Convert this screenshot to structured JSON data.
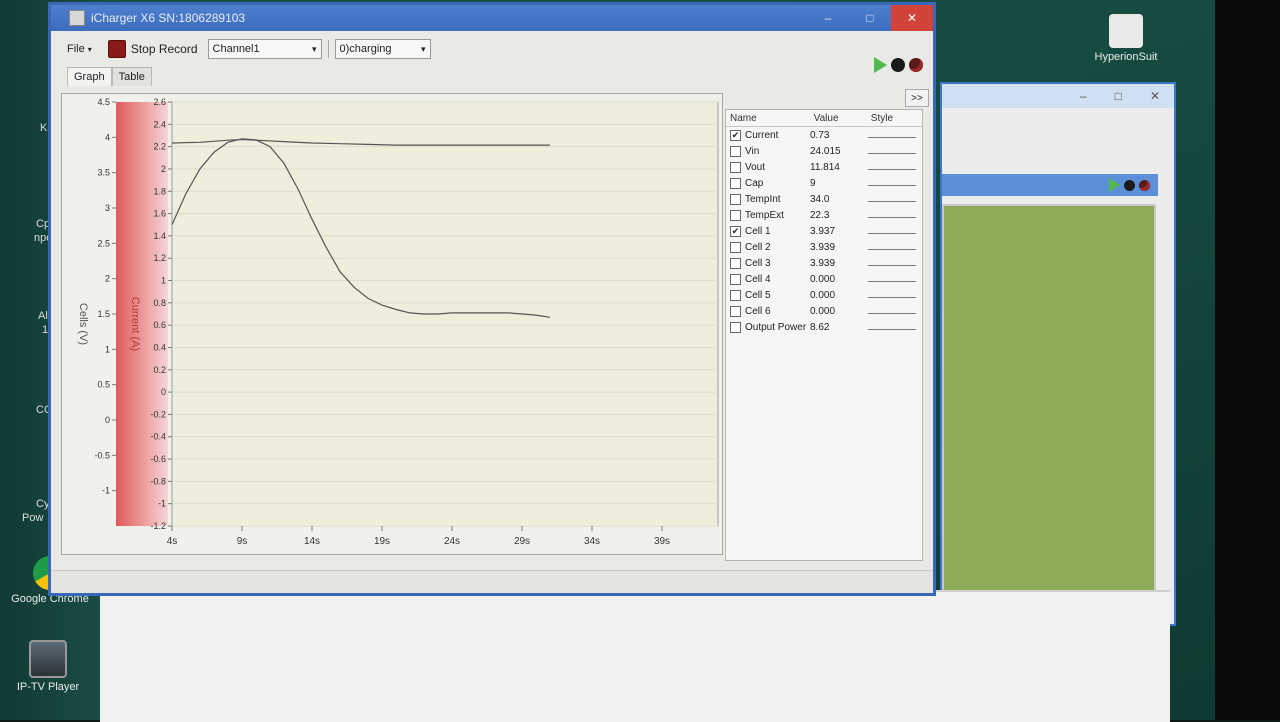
{
  "desktop": {
    "icons": [
      {
        "name": "HyperionSuit"
      },
      {
        "name": "Google Chrome"
      },
      {
        "name": "IP-TV Player"
      }
    ],
    "edge_labels": [
      "Kc",
      "Cp",
      "npc",
      "Al",
      "1",
      "CC",
      "Cy",
      "Pow"
    ]
  },
  "window": {
    "title": "iCharger X6 SN:1806289103",
    "controls": [
      "–",
      "□",
      "✕"
    ]
  },
  "toolbar": {
    "file": "File",
    "stop_record": "Stop Record",
    "channel": "Channel1",
    "mode": "0)charging"
  },
  "tabs": [
    {
      "label": "Graph",
      "active": true
    },
    {
      "label": "Table",
      "active": false
    }
  ],
  "expand_label": ">>",
  "chart_data": {
    "type": "line",
    "x_ticks": [
      "4s",
      "9s",
      "14s",
      "19s",
      "24s",
      "29s",
      "34s",
      "39s"
    ],
    "x_range_s": [
      4,
      43
    ],
    "left_axis": {
      "label": "Cells (V)",
      "range": [
        -1.5,
        4.5
      ],
      "ticks": [
        "4.5",
        "4",
        "3.5",
        "3",
        "2.5",
        "2",
        "1.5",
        "1",
        "0.5",
        "0",
        "-0.5",
        "-1"
      ]
    },
    "right_axis": {
      "label": "Current (A)",
      "range": [
        -1.2,
        2.6
      ],
      "ticks": [
        "2.6",
        "2.4",
        "2.2",
        "2",
        "1.8",
        "1.6",
        "1.4",
        "1.2",
        "1",
        "0.8",
        "0.6",
        "0.4",
        "0.2",
        "0",
        "-0.2",
        "-0.4",
        "-0.6",
        "-0.8",
        "-1",
        "-1.2"
      ]
    },
    "series": [
      {
        "name": "Current",
        "axis": "right",
        "color": "#555555",
        "x": [
          4,
          5,
          6,
          7,
          8,
          9,
          10,
          11,
          12,
          13,
          14,
          15,
          16,
          17,
          18,
          19,
          20,
          21,
          22,
          23,
          24,
          25,
          26,
          27,
          28,
          29,
          30,
          31
        ],
        "y": [
          1.5,
          1.78,
          2.0,
          2.15,
          2.24,
          2.27,
          2.26,
          2.2,
          2.05,
          1.82,
          1.55,
          1.3,
          1.08,
          0.94,
          0.84,
          0.78,
          0.74,
          0.71,
          0.7,
          0.7,
          0.71,
          0.71,
          0.71,
          0.71,
          0.71,
          0.7,
          0.69,
          0.67
        ]
      },
      {
        "name": "Cell 1",
        "axis": "left",
        "color": "#555555",
        "x": [
          4,
          6,
          8,
          9,
          10,
          12,
          14,
          16,
          18,
          20,
          22,
          24,
          26,
          28,
          30,
          31
        ],
        "y": [
          3.92,
          3.93,
          3.96,
          3.97,
          3.96,
          3.94,
          3.92,
          3.91,
          3.9,
          3.89,
          3.89,
          3.89,
          3.89,
          3.89,
          3.89,
          3.89
        ]
      }
    ]
  },
  "legend": {
    "headers": [
      "Name",
      "Value",
      "Style"
    ],
    "rows": [
      {
        "name": "Current",
        "value": "0.73",
        "checked": true
      },
      {
        "name": "Vin",
        "value": "24.015",
        "checked": false
      },
      {
        "name": "Vout",
        "value": "11.814",
        "checked": false
      },
      {
        "name": "Cap",
        "value": "9",
        "checked": false
      },
      {
        "name": "TempInt",
        "value": "34.0",
        "checked": false
      },
      {
        "name": "TempExt",
        "value": "22.3",
        "checked": false
      },
      {
        "name": "Cell 1",
        "value": "3.937",
        "checked": true
      },
      {
        "name": "Cell 2",
        "value": "3.939",
        "checked": false
      },
      {
        "name": "Cell 3",
        "value": "3.939",
        "checked": false
      },
      {
        "name": "Cell 4",
        "value": "0.000",
        "checked": false
      },
      {
        "name": "Cell 5",
        "value": "0.000",
        "checked": false
      },
      {
        "name": "Cell 6",
        "value": "0.000",
        "checked": false
      },
      {
        "name": "Output Power",
        "value": "8.62",
        "checked": false
      }
    ]
  }
}
